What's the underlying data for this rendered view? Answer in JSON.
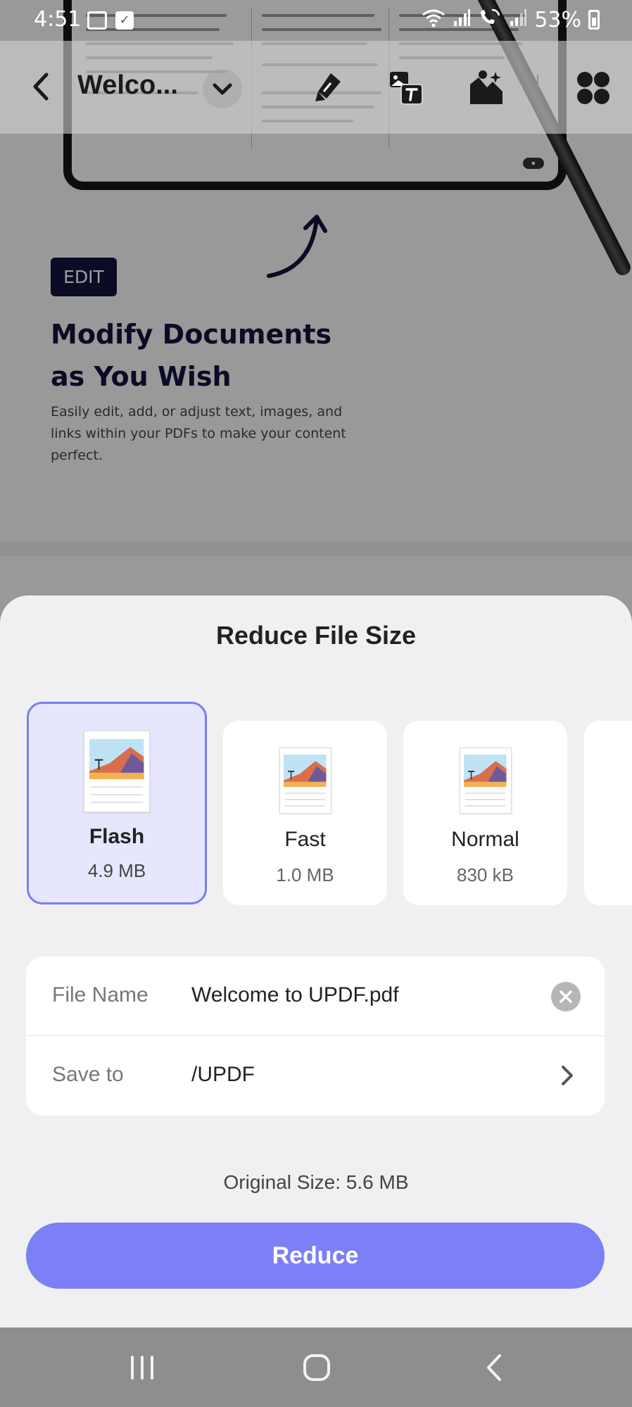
{
  "status_bar": {
    "time": "4:51",
    "battery": "53%"
  },
  "toolbar": {
    "document_title": "Welco..."
  },
  "background_page": {
    "badge": "EDIT",
    "headline": "Modify Documents as You Wish",
    "description": "Easily edit, add, or adjust text, images, and links within your PDFs to make your content perfect."
  },
  "sheet": {
    "title": "Reduce File Size",
    "options": [
      {
        "name": "Flash",
        "size": "4.9 MB",
        "selected": true
      },
      {
        "name": "Fast",
        "size": "1.0 MB",
        "selected": false
      },
      {
        "name": "Normal",
        "size": "830 kB",
        "selected": false
      }
    ],
    "file_name_label": "File Name",
    "file_name_value": "Welcome to UPDF.pdf",
    "save_to_label": "Save to",
    "save_to_value": "/UPDF",
    "original_size": "Original Size: 5.6 MB",
    "reduce_label": "Reduce"
  },
  "colors": {
    "accent": "#7b80f6",
    "selected_bg": "#e6e7fd",
    "sheet_bg": "#f0f0f2",
    "headline": "#12133c"
  }
}
